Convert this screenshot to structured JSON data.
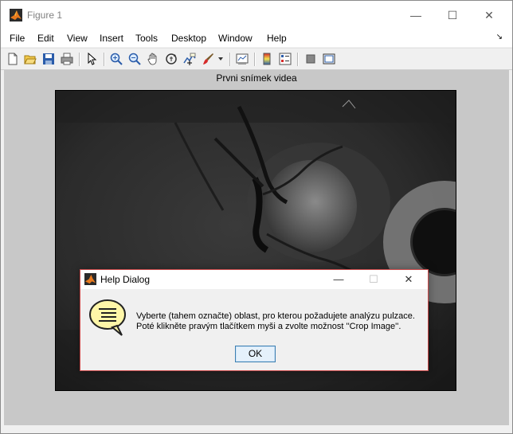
{
  "window": {
    "title": "Figure 1",
    "minimize_glyph": "—",
    "maximize_glyph": "☐",
    "close_glyph": "✕"
  },
  "menubar": {
    "items": [
      "File",
      "Edit",
      "View",
      "Insert",
      "Tools",
      "Desktop",
      "Window",
      "Help"
    ],
    "dock_glyph": "↘"
  },
  "toolbar": {
    "icons": [
      "new-figure-icon",
      "open-file-icon",
      "save-icon",
      "print-icon",
      "select-arrow-icon",
      "zoom-in-icon",
      "zoom-out-icon",
      "pan-hand-icon",
      "rotate-3d-icon",
      "data-cursor-icon",
      "brush-icon",
      "brush-dropdown-icon",
      "link-plot-icon",
      "colorbar-icon",
      "legend-icon",
      "hide-plot-tools-icon",
      "show-plot-tools-icon"
    ]
  },
  "axes": {
    "title": "Prvni snímek videa"
  },
  "dialog": {
    "title": "Help Dialog",
    "message_line1": "Vyberte (tahem označte) oblast, pro kterou požadujete analýzu pulzace.",
    "message_line2": "Poté klikněte pravým tlačítkem myši a zvolte možnost ''Crop Image''.",
    "ok_label": "OK",
    "minimize_glyph": "—",
    "maximize_glyph": "☐",
    "close_glyph": "✕"
  },
  "colors": {
    "figure_bg": "#c8c8c8",
    "dialog_border": "#cc4b4b",
    "ok_border": "#3c7fb1",
    "help_bubble": "#fff6a8"
  }
}
